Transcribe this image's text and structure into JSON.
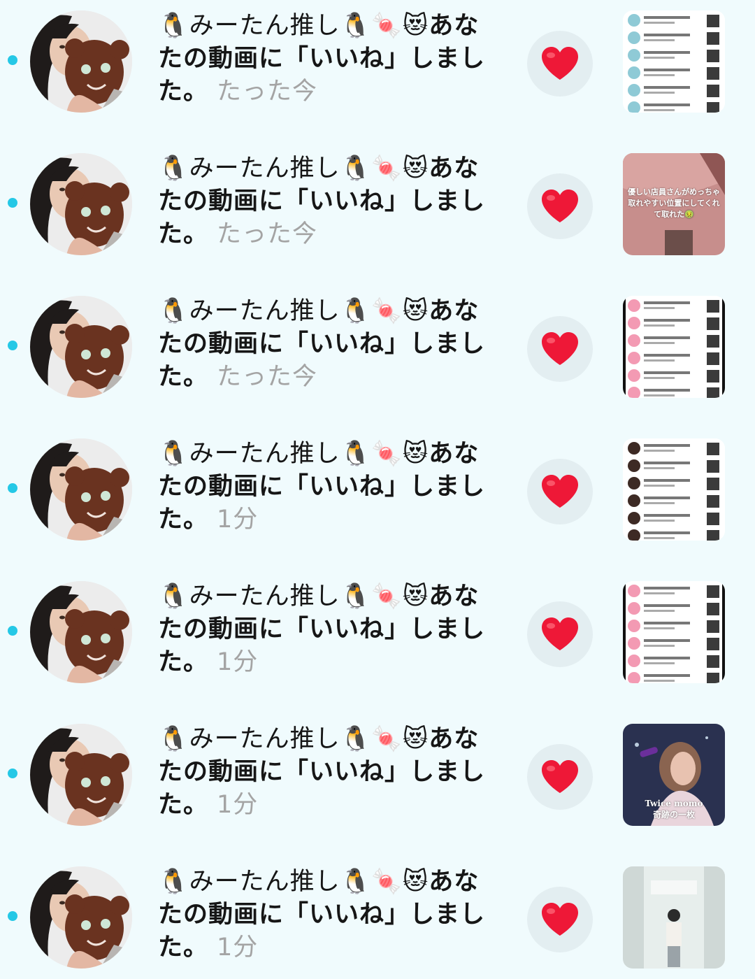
{
  "notifications": [
    {
      "user": "🐧みーたん推し🐧🍬😻",
      "message": "あなたの動画に「いいね」しました。",
      "time": "たった今",
      "thumb_kind": "screenshot-list-a",
      "thumb_caption": ""
    },
    {
      "user": "🐧みーたん推し🐧🍬😻",
      "message": "あなたの動画に「いいね」しました。",
      "time": "たった今",
      "thumb_kind": "pink-photo",
      "thumb_caption": "優しい店員さんがめっちゃ取れやすい位置にしてくれて取れた🤢"
    },
    {
      "user": "🐧みーたん推し🐧🍬😻",
      "message": "あなたの動画に「いいね」しました。",
      "time": "たった今",
      "thumb_kind": "screenshot-list-b",
      "thumb_caption": ""
    },
    {
      "user": "🐧みーたん推し🐧🍬😻",
      "message": "あなたの動画に「いいね」しました。",
      "time": "1分",
      "thumb_kind": "screenshot-list-c",
      "thumb_caption": ""
    },
    {
      "user": "🐧みーたん推し🐧🍬😻",
      "message": "あなたの動画に「いいね」しました。",
      "time": "1分",
      "thumb_kind": "screenshot-list-d",
      "thumb_caption": ""
    },
    {
      "user": "🐧みーたん推し🐧🍬😻",
      "message": "あなたの動画に「いいね」しました。",
      "time": "1分",
      "thumb_kind": "concert-photo",
      "thumb_caption": "Twice momo\n奇跡の一枚"
    },
    {
      "user": "🐧みーたん推し🐧🍬😻",
      "message": "あなたの動画に「いいね」しました。",
      "time": "1分",
      "thumb_kind": "white-photo",
      "thumb_caption": ""
    }
  ],
  "icons": {
    "unread_dot": "unread-dot",
    "like": "heart-icon"
  },
  "colors": {
    "background": "#f0fbfd",
    "unread_dot": "#25c8e6",
    "heart": "#ee1837",
    "time_text": "#a4a4a4"
  }
}
